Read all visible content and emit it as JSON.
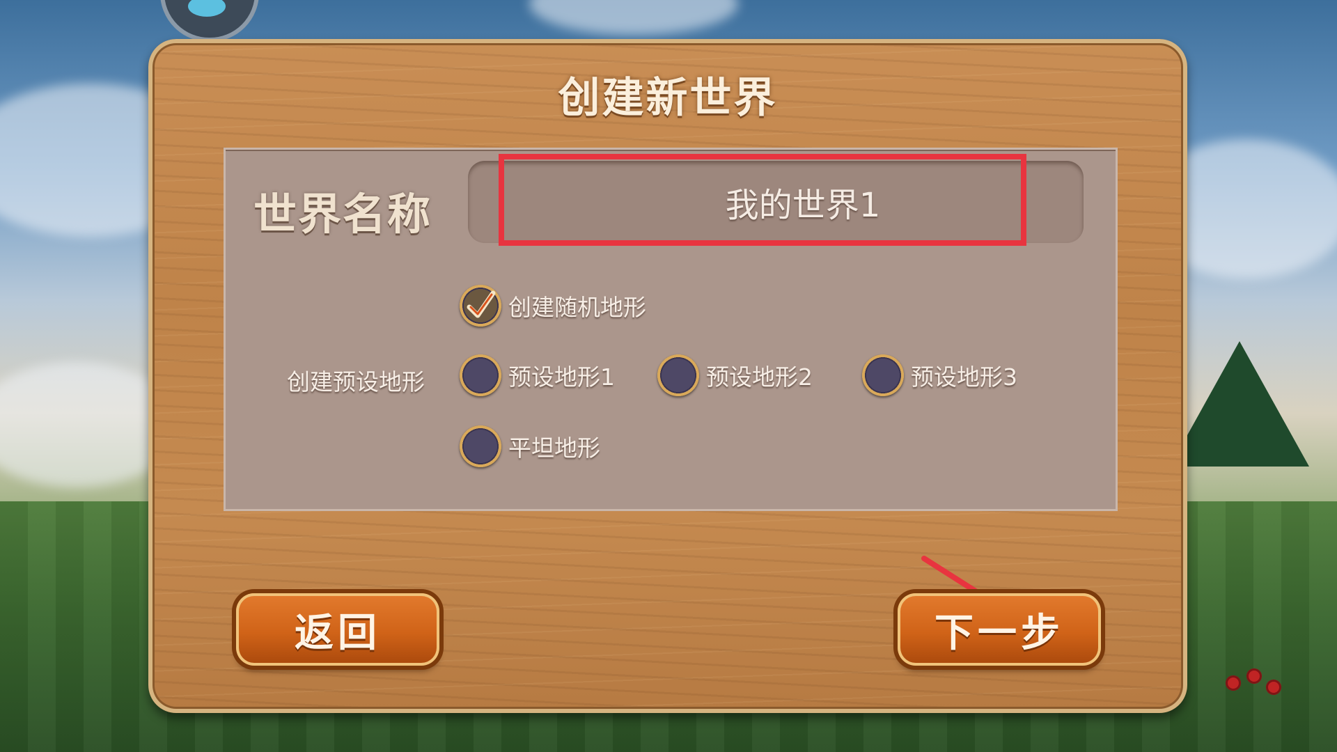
{
  "dialog": {
    "title": "创建新世界",
    "world_name_label": "世界名称",
    "world_name_value": "我的世界1",
    "options": {
      "random_terrain": "创建随机地形",
      "preset_group_label": "创建预设地形",
      "preset1": "预设地形1",
      "preset2": "预设地形2",
      "preset3": "预设地形3",
      "flat": "平坦地形"
    },
    "selected_option": "random_terrain"
  },
  "buttons": {
    "back": "返回",
    "next": "下一步"
  },
  "annotations": {
    "highlight_color": "#e8343f",
    "arrow_color": "#e8343f"
  },
  "colors": {
    "wood": "#c98e55",
    "panel": "#ab968c",
    "button": "#d06318"
  }
}
